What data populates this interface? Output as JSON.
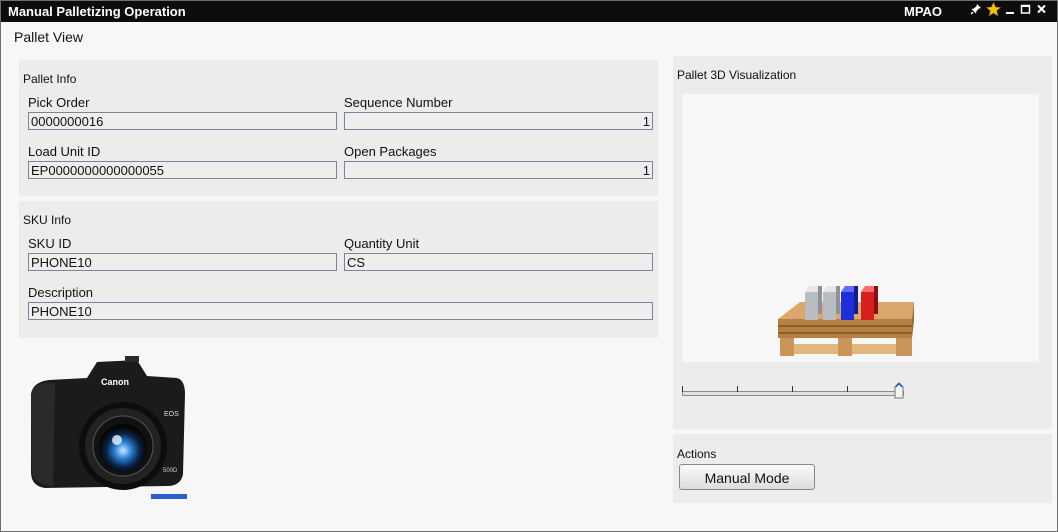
{
  "window": {
    "title": "Manual Palletizing Operation",
    "app_code": "MPAO",
    "controls": [
      "pin-icon",
      "star-icon",
      "minimize-icon",
      "maximize-icon",
      "close-icon"
    ]
  },
  "view_title": "Pallet View",
  "pallet_info": {
    "label": "Pallet Info",
    "pick_order_label": "Pick Order",
    "pick_order_value": "0000000016",
    "sequence_label": "Sequence Number",
    "sequence_value": "1",
    "load_unit_label": "Load Unit ID",
    "load_unit_value": "EP0000000000000055",
    "open_packages_label": "Open Packages",
    "open_packages_value": "1"
  },
  "sku_info": {
    "label": "SKU Info",
    "sku_id_label": "SKU ID",
    "sku_id_value": "PHONE10",
    "quantity_unit_label": "Quantity Unit",
    "quantity_unit_value": "CS",
    "description_label": "Description",
    "description_value": "PHONE10"
  },
  "product_image": {
    "icon": "camera-image",
    "brand": "Canon",
    "model": "EOS",
    "model_number": "500D"
  },
  "visualization": {
    "label": "Pallet 3D Visualization",
    "icon": "pallet-3d-icon",
    "layer_slider": {
      "ticks": 5,
      "level": 1.0
    }
  },
  "actions": {
    "label": "Actions",
    "manual_mode_button": "Manual Mode"
  },
  "colors": {
    "titlebar": "#0d0d0d",
    "panel_bg": "#ececec",
    "field_border": "#7a8599",
    "package_blue": "#1f2fd8",
    "package_red": "#d81f1f",
    "package_grey": "#b9bcc2",
    "pallet_wood": "#c08a4e"
  }
}
